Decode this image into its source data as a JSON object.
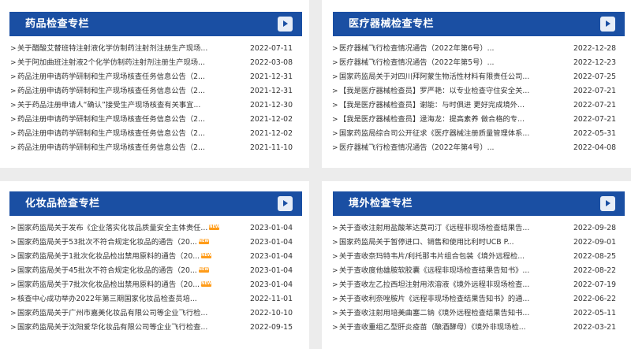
{
  "panels": [
    {
      "title": "药品检查专栏",
      "items": [
        {
          "title": "关于醋酸艾替班特注射液化学仿制药注射剂注册生产现场...",
          "date": "2022-07-11",
          "new": false
        },
        {
          "title": "关于阿加曲班注射液2个化学仿制药注射剂注册生产现场...",
          "date": "2022-03-08",
          "new": false
        },
        {
          "title": "药品注册申请药学研制和生产现场核查任务信息公告（2...",
          "date": "2021-12-31",
          "new": false
        },
        {
          "title": "药品注册申请药学研制和生产现场核查任务信息公告（2...",
          "date": "2021-12-31",
          "new": false
        },
        {
          "title": "关于药品注册申请人“确认”接受生产现场核查有关事宜...",
          "date": "2021-12-30",
          "new": false
        },
        {
          "title": "药品注册申请药学研制和生产现场核查任务信息公告（2...",
          "date": "2021-12-02",
          "new": false
        },
        {
          "title": "药品注册申请药学研制和生产现场核查任务信息公告（2...",
          "date": "2021-12-02",
          "new": false
        },
        {
          "title": "药品注册申请药学研制和生产现场核查任务信息公告（2...",
          "date": "2021-11-10",
          "new": false
        }
      ]
    },
    {
      "title": "医疗器械检查专栏",
      "items": [
        {
          "title": "医疗器械飞行检查情况通告（2022年第6号）...",
          "date": "2022-12-28",
          "new": false
        },
        {
          "title": "医疗器械飞行检查情况通告（2022年第5号）...",
          "date": "2022-12-23",
          "new": false
        },
        {
          "title": "国家药监局关于对四川拜阿蒙生物活性材料有限责任公司...",
          "date": "2022-07-25",
          "new": false
        },
        {
          "title": "【我是医疗器械检查员】罗严艳：以专业检查守住安全关...",
          "date": "2022-07-21",
          "new": false
        },
        {
          "title": "【我是医疗器械检查员】谢能：与时俱进 更好完成境外...",
          "date": "2022-07-21",
          "new": false
        },
        {
          "title": "【我是医疗器械检查员】逯海龙：提高素养 做合格的专...",
          "date": "2022-07-21",
          "new": false
        },
        {
          "title": "国家药监局综合司公开征求《医疗器械注册质量管理体系...",
          "date": "2022-05-31",
          "new": false
        },
        {
          "title": "医疗器械飞行检查情况通告（2022年第4号）...",
          "date": "2022-04-08",
          "new": false
        }
      ]
    },
    {
      "title": "化妆品检查专栏",
      "items": [
        {
          "title": "国家药监局关于发布《企业落实化妆品质量安全主体责任...",
          "date": "2023-01-04",
          "new": true
        },
        {
          "title": "国家药监局关于53批次不符合规定化妆品的通告（20...",
          "date": "2023-01-04",
          "new": true
        },
        {
          "title": "国家药监局关于1批次化妆品检出禁用原料的通告（20...",
          "date": "2023-01-04",
          "new": true
        },
        {
          "title": "国家药监局关于45批次不符合规定化妆品的通告（20...",
          "date": "2023-01-04",
          "new": true
        },
        {
          "title": "国家药监局关于7批次化妆品检出禁用原料的通告（20...",
          "date": "2023-01-04",
          "new": true
        },
        {
          "title": "核查中心成功举办2022年第三期国家化妆品检查员培...",
          "date": "2022-11-01",
          "new": false
        },
        {
          "title": "国家药监局关于广州市嘉美化妆品有限公司等企业飞行检...",
          "date": "2022-10-10",
          "new": false
        },
        {
          "title": "国家药监局关于沈阳爱华化妆品有限公司等企业飞行检查...",
          "date": "2022-09-15",
          "new": false
        }
      ]
    },
    {
      "title": "境外检查专栏",
      "items": [
        {
          "title": "关于查收注射用盐酸苯达莫司汀《远程非现场检查结果告...",
          "date": "2022-09-28",
          "new": false
        },
        {
          "title": "国家药监局关于暂停进口、销售和使用比利时UCB P...",
          "date": "2022-09-01",
          "new": false
        },
        {
          "title": "关于查收奈玛特韦片/利托那韦片组合包装《境外远程检...",
          "date": "2022-08-25",
          "new": false
        },
        {
          "title": "关于查收度他雄胺软胶囊《远程非现场检查结果告知书》...",
          "date": "2022-08-22",
          "new": false
        },
        {
          "title": "关于查收左乙拉西坦注射用浓溶液《境外远程非现场检查...",
          "date": "2022-07-19",
          "new": false
        },
        {
          "title": "关于查收利奈唑胺片《远程非现场检查结果告知书》的通...",
          "date": "2022-06-22",
          "new": false
        },
        {
          "title": "关于查收注射用培美曲塞二钠《境外远程检查结果告知书...",
          "date": "2022-05-11",
          "new": false
        },
        {
          "title": "关于查收重组乙型肝炎疫苗（酿酒酵母）《境外非现场检...",
          "date": "2022-03-21",
          "new": false
        }
      ]
    }
  ],
  "arrow_glyph": ">",
  "new_badge_label": "NEW",
  "colors": {
    "header_bg": "#1a4fa3",
    "page_bg": "#ececec",
    "badge": "#ff9c1a"
  }
}
